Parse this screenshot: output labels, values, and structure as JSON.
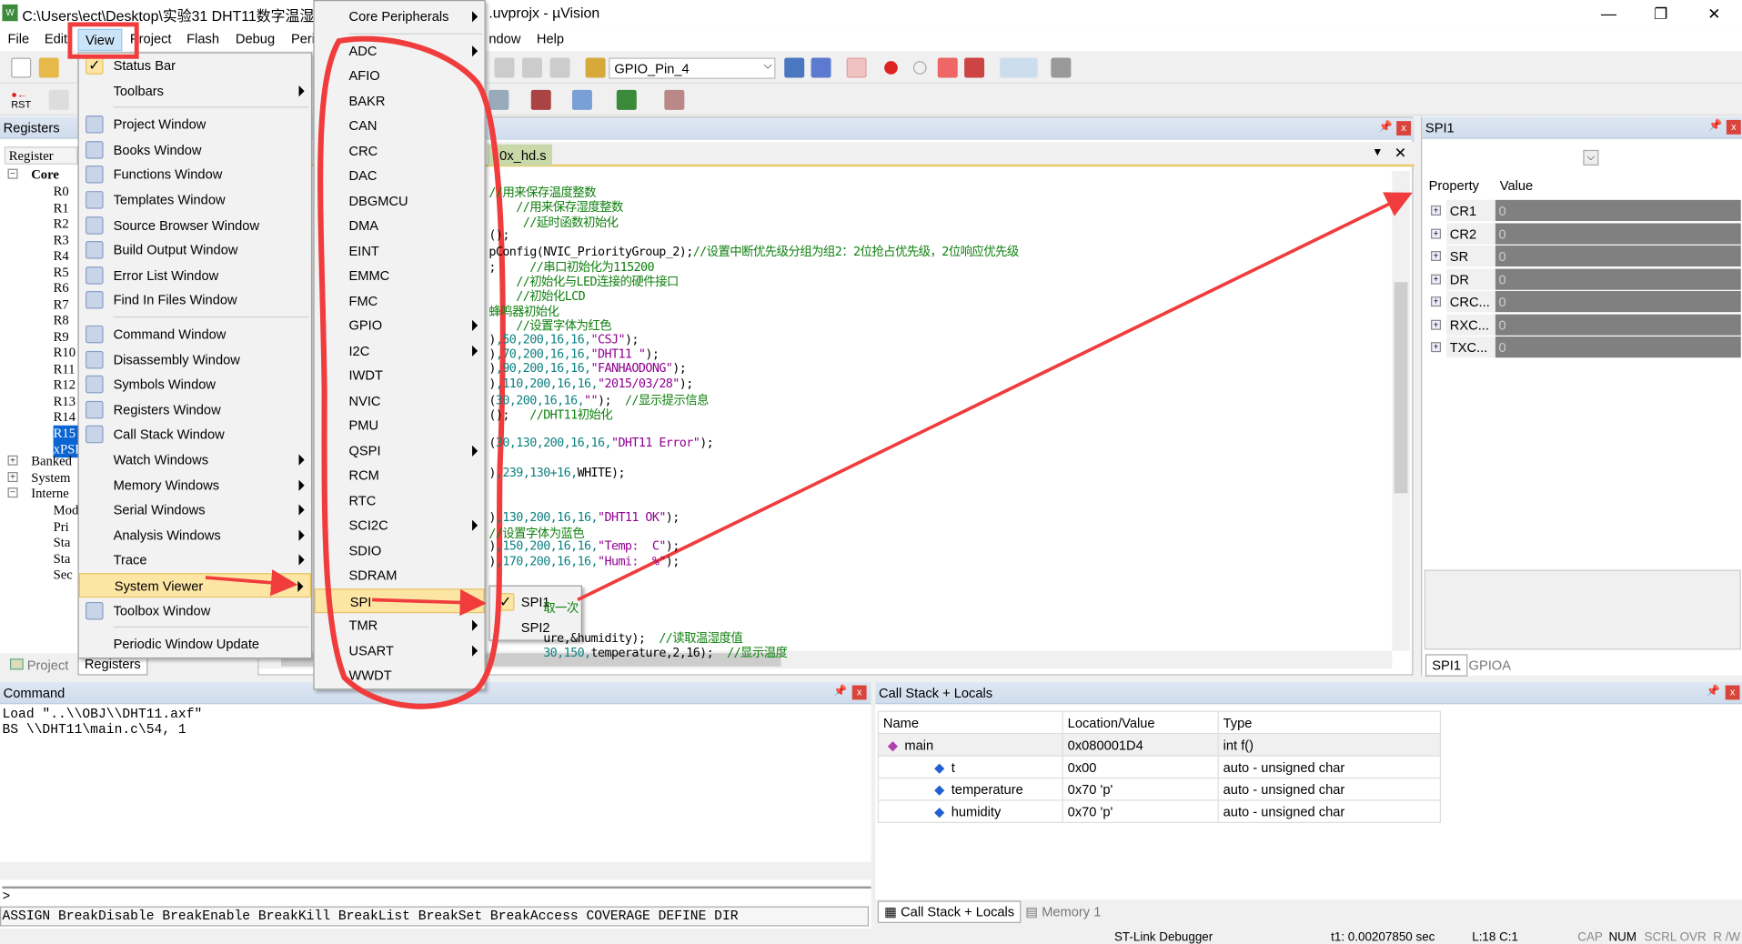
{
  "window": {
    "title": "C:\\Users\\ect\\Desktop\\实验31 DHT11数字温湿 ... .uvprojx - µVision",
    "title_left": "C:\\Users\\ect\\Desktop\\实验31 DHT11数字温湿",
    "title_right": ".uvprojx - µVision",
    "app_icon": "W",
    "minimize": "—",
    "restore": "❐",
    "close": "✕"
  },
  "menubar": [
    "File",
    "Edit",
    "View",
    "Project",
    "Flash",
    "Debug",
    "Peri",
    "ndow",
    "Help"
  ],
  "toolbar": {
    "target_select": "GPIO_Pin_4",
    "rst": "RST"
  },
  "registers_panel": {
    "title": "Registers",
    "column": "Register",
    "core": "Core",
    "regs": [
      "R0",
      "R1",
      "R2",
      "R3",
      "R4",
      "R5",
      "R6",
      "R7",
      "R8",
      "R9",
      "R10",
      "R11",
      "R12",
      "R13",
      "R14",
      "R15",
      "xPSR"
    ],
    "groups": [
      "Banked",
      "System",
      "Interne"
    ],
    "internal": [
      "Mod",
      "Pri",
      "Sta",
      "Sta",
      "Sec"
    ],
    "tabs": [
      "Project",
      "Registers"
    ]
  },
  "editor": {
    "tab": "10x_hd.s",
    "lines": [
      [
        [
          "//用来保存温度整数",
          "c-g"
        ]
      ],
      [
        [
          "    //用来保存湿度整数",
          "c-g"
        ]
      ],
      [
        [
          "     //延时函数初始化",
          "c-g"
        ]
      ],
      [
        [
          "();",
          "c-k"
        ]
      ],
      [
        [
          "pConfig(NVIC_PriorityGroup_2);",
          "c-k"
        ],
        [
          "//设置中断优先级分组为组2：2位抢占优先级，2位响应优先级",
          "c-g"
        ]
      ],
      [
        [
          ";     ",
          "c-k"
        ],
        [
          "//串口初始化为115200",
          "c-g"
        ]
      ],
      [
        [
          "    //初始化与LED连接的硬件接口",
          "c-g"
        ]
      ],
      [
        [
          "    //初始化LCD",
          "c-g"
        ]
      ],
      [
        [
          "蜂鸣器初始化",
          "c-g"
        ]
      ],
      [
        [
          "    //设置字体为红色",
          "c-g"
        ]
      ],
      [
        [
          ")",
          "c-k"
        ],
        [
          ",50,200,16,16,",
          "c-t"
        ],
        [
          "\"CSJ\"",
          "c-p"
        ],
        [
          ");",
          "c-k"
        ]
      ],
      [
        [
          ")",
          "c-k"
        ],
        [
          ",70,200,16,16,",
          "c-t"
        ],
        [
          "\"DHT11 \"",
          "c-p"
        ],
        [
          ");",
          "c-k"
        ]
      ],
      [
        [
          ")",
          "c-k"
        ],
        [
          ",90,200,16,16,",
          "c-t"
        ],
        [
          "\"FANHAODONG\"",
          "c-p"
        ],
        [
          ");",
          "c-k"
        ]
      ],
      [
        [
          ")",
          "c-k"
        ],
        [
          ",110,200,16,16,",
          "c-t"
        ],
        [
          "\"2015/03/28\"",
          "c-p"
        ],
        [
          ");",
          "c-k"
        ]
      ],
      [
        [
          "(",
          "c-k"
        ],
        [
          "30,200,16,16,",
          "c-t"
        ],
        [
          "\"\"",
          "c-p"
        ],
        [
          ");  ",
          "c-k"
        ],
        [
          "//显示提示信息",
          "c-g"
        ]
      ],
      [
        [
          "();   ",
          "c-k"
        ],
        [
          "//DHT11初始化",
          "c-g"
        ]
      ],
      [
        [
          "",
          "c-k"
        ]
      ],
      [
        [
          "(",
          "c-k"
        ],
        [
          "30,130,200,16,16,",
          "c-t"
        ],
        [
          "\"DHT11 Error\"",
          "c-p"
        ],
        [
          ");",
          "c-k"
        ]
      ],
      [
        [
          "",
          "c-k"
        ]
      ],
      [
        [
          ")",
          "c-k"
        ],
        [
          ",239,130+16,",
          "c-t"
        ],
        [
          "WHITE);",
          "c-k"
        ]
      ],
      [
        [
          "",
          "c-k"
        ]
      ],
      [
        [
          "",
          "c-k"
        ]
      ],
      [
        [
          ")",
          "c-k"
        ],
        [
          ",130,200,16,16,",
          "c-t"
        ],
        [
          "\"DHT11 OK\"",
          "c-p"
        ],
        [
          ");",
          "c-k"
        ]
      ],
      [
        [
          "//设置字体为蓝色",
          "c-g"
        ]
      ],
      [
        [
          ")",
          "c-k"
        ],
        [
          ",150,200,16,16,",
          "c-t"
        ],
        [
          "\"Temp:  C\"",
          "c-p"
        ],
        [
          ");",
          "c-k"
        ]
      ],
      [
        [
          ")",
          "c-k"
        ],
        [
          ",170,200,16,16,",
          "c-t"
        ],
        [
          "\"Humi:  %\"",
          "c-p"
        ],
        [
          ");",
          "c-k"
        ]
      ],
      [
        [
          "",
          "c-k"
        ]
      ],
      [
        [
          "",
          "c-k"
        ]
      ],
      [
        [
          "        取一次",
          "c-g"
        ]
      ],
      [
        [
          "",
          "c-k"
        ]
      ],
      [
        [
          "        ure,&humidity);  ",
          "c-k"
        ],
        [
          "//读取温湿度值",
          "c-g"
        ]
      ],
      [
        [
          "        ",
          "c-k"
        ],
        [
          "30,150,",
          "c-t"
        ],
        [
          "temperature,2,16);  ",
          "c-k"
        ],
        [
          "//显示温度",
          "c-g"
        ]
      ]
    ]
  },
  "view_menu": [
    {
      "label": "Status Bar",
      "icon": "check-icon",
      "checked": true
    },
    {
      "label": "Toolbars",
      "submenu": true
    },
    {
      "sep": true
    },
    {
      "label": "Project Window",
      "icon": "project-window-icon"
    },
    {
      "label": "Books Window",
      "icon": "books-icon"
    },
    {
      "label": "Functions Window",
      "icon": "functions-icon"
    },
    {
      "label": "Templates Window",
      "icon": "templates-icon"
    },
    {
      "label": "Source Browser Window",
      "icon": "source-browser-icon"
    },
    {
      "label": "Build Output Window",
      "icon": "build-output-icon"
    },
    {
      "label": "Error List Window",
      "icon": "error-icon"
    },
    {
      "label": "Find In Files Window",
      "icon": "find-icon"
    },
    {
      "sep": true
    },
    {
      "label": "Command Window",
      "icon": "command-icon"
    },
    {
      "label": "Disassembly Window",
      "icon": "disassembly-icon"
    },
    {
      "label": "Symbols Window",
      "icon": "symbols-icon"
    },
    {
      "label": "Registers Window",
      "icon": "registers-icon"
    },
    {
      "label": "Call Stack Window",
      "icon": "call-stack-icon"
    },
    {
      "label": "Watch Windows",
      "submenu": true
    },
    {
      "label": "Memory Windows",
      "submenu": true
    },
    {
      "label": "Serial Windows",
      "submenu": true
    },
    {
      "label": "Analysis Windows",
      "submenu": true
    },
    {
      "label": "Trace",
      "submenu": true
    },
    {
      "label": "System Viewer",
      "submenu": true,
      "highlighted": true
    },
    {
      "label": "Toolbox Window",
      "icon": "toolbox-icon"
    },
    {
      "sep": true
    },
    {
      "label": "Periodic Window Update"
    }
  ],
  "system_viewer_menu": [
    {
      "label": "Core Peripherals",
      "submenu": true
    },
    {
      "sep": true
    },
    {
      "label": "ADC",
      "submenu": true
    },
    {
      "label": "AFIO"
    },
    {
      "label": "BAKR"
    },
    {
      "label": "CAN"
    },
    {
      "label": "CRC"
    },
    {
      "label": "DAC"
    },
    {
      "label": "DBGMCU"
    },
    {
      "label": "DMA"
    },
    {
      "label": "EINT"
    },
    {
      "label": "EMMC"
    },
    {
      "label": "FMC"
    },
    {
      "label": "GPIO",
      "submenu": true
    },
    {
      "label": "I2C",
      "submenu": true
    },
    {
      "label": "IWDT"
    },
    {
      "label": "NVIC"
    },
    {
      "label": "PMU"
    },
    {
      "label": "QSPI",
      "submenu": true
    },
    {
      "label": "RCM"
    },
    {
      "label": "RTC"
    },
    {
      "label": "SCI2C",
      "submenu": true
    },
    {
      "label": "SDIO"
    },
    {
      "label": "SDRAM"
    },
    {
      "label": "SPI",
      "submenu": true,
      "highlighted": true
    },
    {
      "label": "TMR",
      "submenu": true
    },
    {
      "label": "USART",
      "submenu": true
    },
    {
      "label": "WWDT"
    }
  ],
  "spi_menu": [
    {
      "label": "SPI1",
      "checked": true
    },
    {
      "label": "SPI2"
    }
  ],
  "spi1_panel": {
    "title": "SPI1",
    "col_property": "Property",
    "col_value": "Value",
    "rows": [
      {
        "name": "CR1",
        "value": "0"
      },
      {
        "name": "CR2",
        "value": "0"
      },
      {
        "name": "SR",
        "value": "0"
      },
      {
        "name": "DR",
        "value": "0"
      },
      {
        "name": "CRC...",
        "value": "0"
      },
      {
        "name": "RXC...",
        "value": "0"
      },
      {
        "name": "TXC...",
        "value": "0"
      }
    ],
    "tabs": [
      "SPI1",
      "GPIOA"
    ]
  },
  "command_panel": {
    "title": "Command",
    "lines": [
      "Load \"..\\\\OBJ\\\\DHT11.axf\"",
      "BS \\\\DHT11\\main.c\\54, 1"
    ],
    "prompt": ">",
    "hint": "ASSIGN BreakDisable BreakEnable BreakKill BreakList BreakSet BreakAccess COVERAGE DEFINE DIR"
  },
  "callstack_panel": {
    "title": "Call Stack + Locals",
    "columns": [
      "Name",
      "Location/Value",
      "Type"
    ],
    "rows": [
      {
        "name": "main",
        "value": "0x080001D4",
        "type": "int f()"
      },
      {
        "name": "t",
        "value": "0x00",
        "type": "auto - unsigned char"
      },
      {
        "name": "temperature",
        "value": "0x70 'p'",
        "type": "auto - unsigned char"
      },
      {
        "name": "humidity",
        "value": "0x70 'p'",
        "type": "auto - unsigned char"
      }
    ],
    "tabs": [
      "Call Stack + Locals",
      "Memory 1"
    ]
  },
  "statusbar": {
    "debugger": "ST-Link Debugger",
    "time": "t1: 0.00207850 sec",
    "pos": "L:18 C:1",
    "flags": [
      "CAP",
      "NUM",
      "SCRL",
      "OVR",
      "R /W"
    ]
  },
  "colors": {
    "annotation": "#f03c3c",
    "menu_highlight": "#fde5a4",
    "selection": "#0a64d2"
  }
}
